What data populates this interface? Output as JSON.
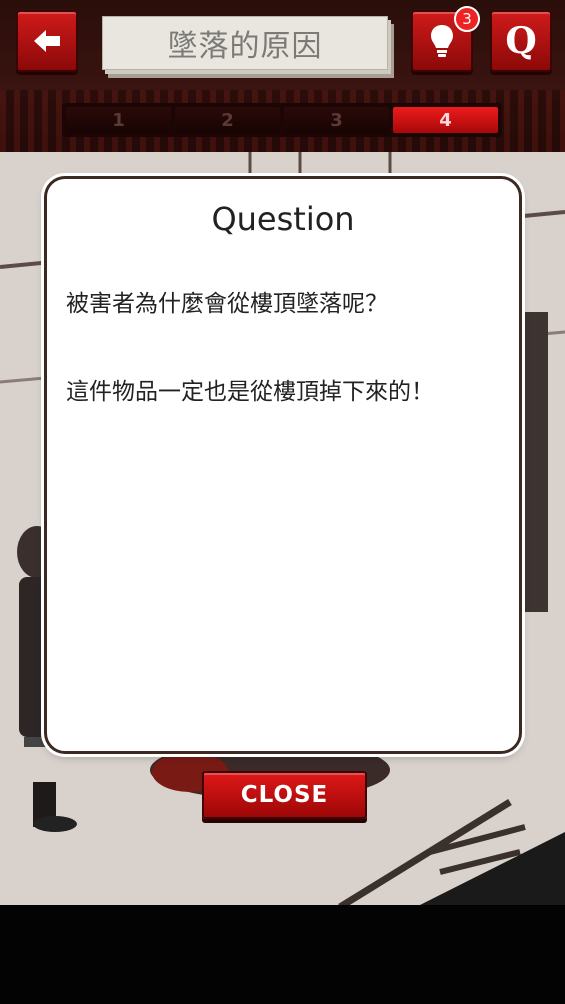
{
  "header": {
    "title": "墜落的原因",
    "hint_count": "3",
    "q_label": "Q",
    "tabs": [
      {
        "label": "1",
        "active": false
      },
      {
        "label": "2",
        "active": false
      },
      {
        "label": "3",
        "active": false
      },
      {
        "label": "4",
        "active": true
      }
    ]
  },
  "modal": {
    "title": "Question",
    "line1": "被害者為什麼會從樓頂墜落呢？",
    "line2": "這件物品一定也是從樓頂掉下來的！"
  },
  "close_label": "CLOSE",
  "colors": {
    "accent_red": "#d01a1a",
    "header_bg": "#2a0e0a",
    "modal_border": "#3c2a22"
  },
  "icons": [
    "back-arrow-icon",
    "lightbulb-hint-icon",
    "question-icon"
  ]
}
